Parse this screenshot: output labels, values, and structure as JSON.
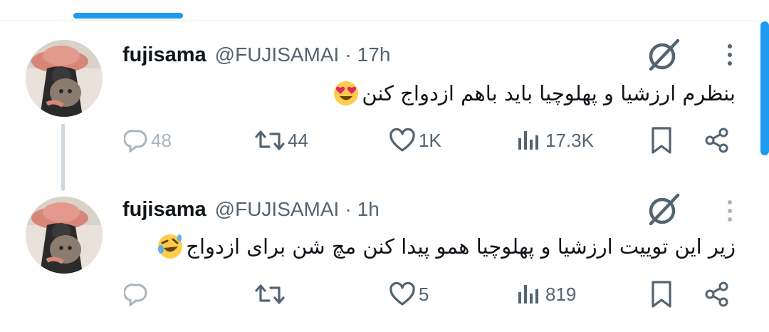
{
  "tweets": [
    {
      "name": "fujisama",
      "handle": "@FUJISAMAI",
      "separator": "·",
      "time": "17h",
      "text": "بنظرم ارزشیا و پهلوچیا باید باهم ازدواج کنن",
      "emoji": "smiling-face-with-heart-eyes",
      "replies": "48",
      "reposts": "44",
      "likes": "1K",
      "views": "17.3K"
    },
    {
      "name": "fujisama",
      "handle": "@FUJISAMAI",
      "separator": "·",
      "time": "1h",
      "text": "زیر این توییت ارزشیا و پهلوچیا همو پیدا کنن مچ شن برای ازدواج",
      "emoji": "rolling-on-the-floor-laughing",
      "replies": "",
      "reposts": "",
      "likes": "5",
      "views": "819"
    }
  ],
  "colors": {
    "accent": "#1d9bf0",
    "text": "#0f1419",
    "secondary": "#536471",
    "divider": "#cfd9de"
  }
}
